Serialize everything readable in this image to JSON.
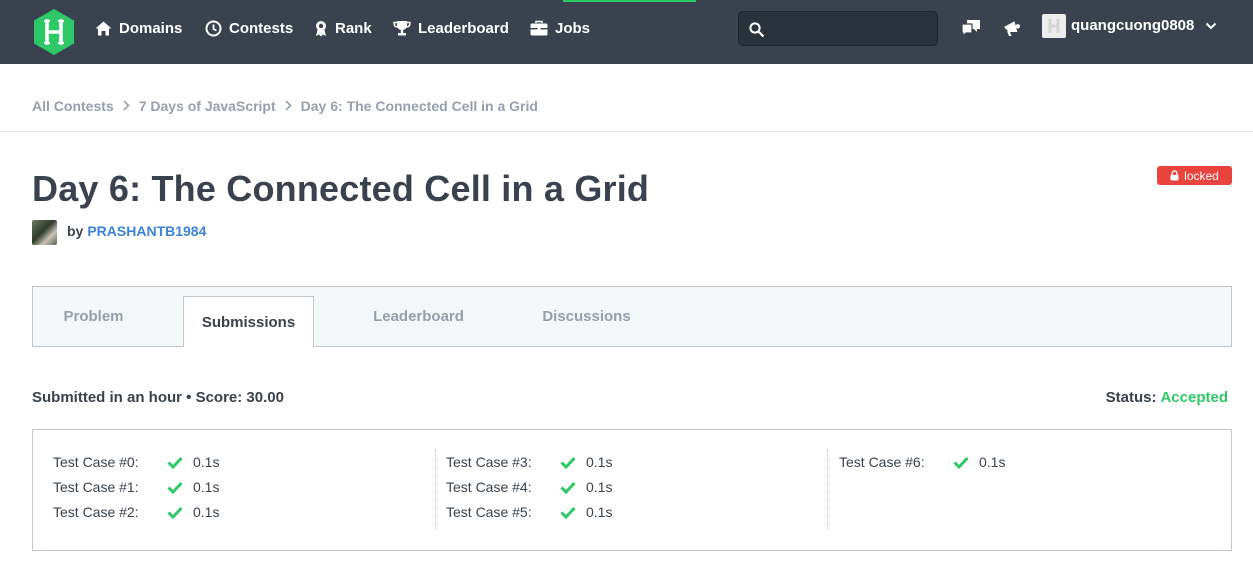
{
  "nav": {
    "logo_letter": "H",
    "items": [
      {
        "label": "Domains",
        "icon": "home-icon"
      },
      {
        "label": "Contests",
        "icon": "clock-icon"
      },
      {
        "label": "Rank",
        "icon": "medal-icon"
      },
      {
        "label": "Leaderboard",
        "icon": "trophy-icon"
      },
      {
        "label": "Jobs",
        "icon": "briefcase-icon"
      }
    ],
    "search_placeholder": "",
    "username": "quangcuong0808",
    "colors": {
      "bar": "#39424e",
      "accent": "#2ec866",
      "logo": "#2ec866"
    }
  },
  "breadcrumb": [
    {
      "label": "All Contests"
    },
    {
      "label": "7 Days of JavaScript"
    },
    {
      "label": "Day 6: The Connected Cell in a Grid"
    }
  ],
  "challenge": {
    "title": "Day 6: The Connected Cell in a Grid",
    "locked_label": "locked",
    "by_label": "by",
    "author": "PRASHANTB1984"
  },
  "tabs": [
    {
      "label": "Problem",
      "active": false
    },
    {
      "label": "Submissions",
      "active": true
    },
    {
      "label": "Leaderboard",
      "active": false
    },
    {
      "label": "Discussions",
      "active": false
    }
  ],
  "submission": {
    "summary": "Submitted in an hour • Score: 30.00",
    "status_label": "Status:",
    "status_value": "Accepted",
    "status_color": "#2ec866"
  },
  "test_cases": [
    {
      "label": "Test Case #0:",
      "time": "0.1s"
    },
    {
      "label": "Test Case #1:",
      "time": "0.1s"
    },
    {
      "label": "Test Case #2:",
      "time": "0.1s"
    },
    {
      "label": "Test Case #3:",
      "time": "0.1s"
    },
    {
      "label": "Test Case #4:",
      "time": "0.1s"
    },
    {
      "label": "Test Case #5:",
      "time": "0.1s"
    },
    {
      "label": "Test Case #6:",
      "time": "0.1s"
    }
  ]
}
